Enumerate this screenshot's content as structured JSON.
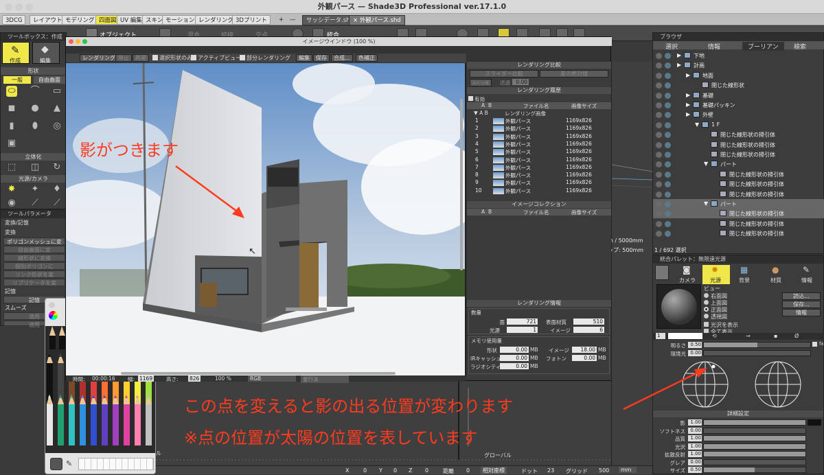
{
  "window": {
    "title": "外観パース — Shade3D Professional ver.17.1.0"
  },
  "tabs": {
    "perspectives": [
      "3DCG",
      "レイアウト",
      "モデリング",
      "四面図",
      "UV 編集",
      "スキン",
      "モーション",
      "レンダリング",
      "3Dプリント",
      "+",
      "—"
    ],
    "documents": [
      "サッシデータ.shd",
      "× 外観パース.shd"
    ]
  },
  "toolbar": {
    "object_label": "オブジェクト",
    "integrate_label": "統合",
    "shade_labels": [
      "混合",
      "結線",
      "交点"
    ]
  },
  "toolbox": {
    "title": "ツールボックス：作成",
    "modes": [
      "作成",
      "編集"
    ],
    "shape_section": "形状",
    "shape_tabs": [
      "一般",
      "自由曲面"
    ],
    "solid_section": "立体化",
    "light_section": "光源/カメラ"
  },
  "tool_params": {
    "title": "ツールパラメータ",
    "subtitle": "変換/記憶",
    "convert_label": "変換",
    "convert_buttons": [
      "ポリゴンメッシュに変",
      "自由曲面に変",
      "線形状に変換",
      "個別ポリゴンに",
      "リンク形状を実",
      "リプリケータを実"
    ],
    "memory_label": "記憶",
    "memory_button": "記憶",
    "smooth_label": "スムーズ",
    "extra_buttons": [
      "適用",
      "適用"
    ]
  },
  "image_window": {
    "title": "イメージウインドウ (100 %)",
    "toolbar": [
      "レンダリング",
      "停止",
      "再開"
    ],
    "checkboxes": [
      "選択形状のみ",
      "アクティブビュー",
      "部分レンダリング"
    ],
    "menus": [
      "編集",
      "保存",
      "合成...",
      "色補正"
    ],
    "status": {
      "time_label": "時間:",
      "time": "00:00:16",
      "width_label": "幅:",
      "width": "1169",
      "height_label": "高さ:",
      "height": "826",
      "zoom": "100 %",
      "channel": "RGB",
      "mode": "並行法"
    }
  },
  "render_compare": {
    "header": "レンダリング比較",
    "slider_btn": "スライダー比較",
    "abs_btn": "差の絶対値",
    "ab_btn": "A<->B",
    "transparency_label": "透過",
    "transparency": "0.00"
  },
  "render_history": {
    "header": "レンダリング履歴",
    "enabled": "有効",
    "columns": [
      "A",
      "B",
      "ファイル名",
      "画像サイズ"
    ],
    "group": "レンダリング画像",
    "rows": [
      {
        "n": "1",
        "name": "外観パース",
        "size": "1169x826"
      },
      {
        "n": "2",
        "name": "外観パース",
        "size": "1169x826"
      },
      {
        "n": "3",
        "name": "外観パース",
        "size": "1169x826"
      },
      {
        "n": "4",
        "name": "外観パース",
        "size": "1169x826"
      },
      {
        "n": "5",
        "name": "外観パース",
        "size": "1169x826"
      },
      {
        "n": "6",
        "name": "外観パース",
        "size": "1169x826"
      },
      {
        "n": "7",
        "name": "外観パース",
        "size": "1169x826"
      },
      {
        "n": "8",
        "name": "外観パース",
        "size": "1169x826"
      },
      {
        "n": "9",
        "name": "外観パース",
        "size": "1169x826"
      },
      {
        "n": "10",
        "name": "外観パース",
        "size": "1169x826"
      }
    ]
  },
  "image_collection": {
    "header": "イメージコレクション",
    "columns": [
      "A",
      "B",
      "ファイル名",
      "画像サイズ"
    ]
  },
  "render_info": {
    "header": "レンダリング情報",
    "count_label": "数量",
    "face_label": "面",
    "face": "721",
    "surface_label": "表面材質",
    "surface": "510",
    "light_label": "光源",
    "light": "1",
    "image_label": "イメージ",
    "image": "6",
    "memory_label": "メモリ使用量",
    "shape_label": "形状",
    "shape": "0.00",
    "image_mem_label": "イメージ",
    "image_mem": "18.00",
    "ir_label": "IRキャッシュ",
    "ir": "0.00",
    "photon_label": "フォトン",
    "photon": "0.00",
    "radio_label": "ラジオシティ",
    "radio": "0.00",
    "unit": "MB"
  },
  "browser": {
    "title": "ブラウザ",
    "tabs": [
      "選択",
      "情報",
      "ブーリアン",
      "検索"
    ],
    "items": [
      {
        "depth": 0,
        "label": "下地",
        "type": "folder"
      },
      {
        "depth": 0,
        "label": "計画",
        "type": "folder"
      },
      {
        "depth": 1,
        "label": "地面",
        "type": "folder"
      },
      {
        "depth": 2,
        "label": "閉じた線形状",
        "type": "shape"
      },
      {
        "depth": 1,
        "label": "基礎",
        "type": "folder"
      },
      {
        "depth": 1,
        "label": "基礎パッキン",
        "type": "folder"
      },
      {
        "depth": 1,
        "label": "外壁",
        "type": "folder"
      },
      {
        "depth": 2,
        "label": "1 F",
        "type": "folder"
      },
      {
        "depth": 3,
        "label": "閉じた線形状の掃引体",
        "type": "shape"
      },
      {
        "depth": 3,
        "label": "閉じた線形状の掃引体",
        "type": "shape"
      },
      {
        "depth": 3,
        "label": "閉じた線形状の掃引体",
        "type": "shape"
      },
      {
        "depth": 3,
        "label": "パート",
        "type": "folder"
      },
      {
        "depth": 4,
        "label": "閉じた線形状の掃引体",
        "type": "shape"
      },
      {
        "depth": 4,
        "label": "閉じた線形状の掃引体",
        "type": "shape"
      },
      {
        "depth": 4,
        "label": "閉じた線形状の掃引体",
        "type": "shape"
      },
      {
        "depth": 3,
        "label": "パート",
        "type": "folder",
        "selected": true
      },
      {
        "depth": 4,
        "label": "閉じた線形状の掃引体",
        "type": "shape",
        "selected": true
      },
      {
        "depth": 4,
        "label": "閉じた線形状の掃引体",
        "type": "shape"
      },
      {
        "depth": 4,
        "label": "閉じた線形状の掃引体",
        "type": "shape"
      }
    ],
    "status": "1 / 692 選択"
  },
  "viewport": {
    "readout1": "m / 5000mm",
    "readout2": "ップ: 500mm",
    "axis_label": "グローバル",
    "left_label": "ル"
  },
  "integrated_palette": {
    "title": "統合パレット：無限遠光源",
    "tabs": [
      "カメラ",
      "光源",
      "背景",
      "材質",
      "情報"
    ],
    "view_label": "ビュー",
    "view_options": [
      "右面図",
      "上面図",
      "正面図",
      "透視図"
    ],
    "checks": [
      "光沢を表示",
      "全て表示"
    ],
    "buttons": [
      "読込...",
      "保存...",
      "情報"
    ],
    "index": "1",
    "brightness_label": "明るさ",
    "brightness": "0.50",
    "brightness_fill": 0.5,
    "ambient_label": "環境光",
    "ambient": "0.00",
    "ambient_fill": 0.0,
    "fx": "fx",
    "detail_header": "詳細設定",
    "details": [
      {
        "label": "影",
        "value": "1.00",
        "fill": 1.0
      },
      {
        "label": "ソフトネス",
        "value": "0.00",
        "fill": 0.0
      },
      {
        "label": "品質",
        "value": "1.00",
        "fill": 1.0
      },
      {
        "label": "光沢",
        "value": "1.00",
        "fill": 1.0
      },
      {
        "label": "拡散反射",
        "value": "1.00",
        "fill": 1.0
      },
      {
        "label": "グレア",
        "value": "0.00",
        "fill": 0.0
      },
      {
        "label": "サイズ",
        "value": "0.50",
        "fill": 0.5
      }
    ]
  },
  "statusbar": {
    "x_label": "X",
    "x": "0",
    "y_label": "Y",
    "y": "0",
    "z_label": "Z",
    "z": "0",
    "dist_label": "距離",
    "dist": "0",
    "coord": "相対座標",
    "dot_label": "ドット",
    "dot": "23",
    "grid_label": "グリッド",
    "grid": "500",
    "unit": "mm"
  },
  "annotations": {
    "shadow": "影がつきます",
    "point": "この点を変えると影の出る位置が変わります",
    "note": "※点の位置が太陽の位置を表しています"
  },
  "colors": {
    "accent": "#f0e84a",
    "annotation": "#ff3b1f"
  }
}
